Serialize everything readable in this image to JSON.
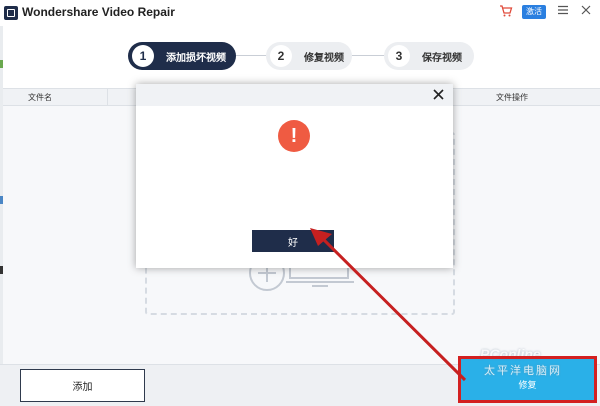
{
  "titlebar": {
    "title": "Wondershare Video Repair",
    "register_label": "激活",
    "icons": [
      "cart-icon",
      "menu-icon",
      "close-icon"
    ]
  },
  "steps": [
    {
      "number": "1",
      "label": "添加损坏视频",
      "state": "active"
    },
    {
      "number": "2",
      "label": "修复视频",
      "state": "inactive"
    },
    {
      "number": "3",
      "label": "保存视频",
      "state": "inactive"
    }
  ],
  "table": {
    "columns": [
      "文件名",
      "文件操作"
    ]
  },
  "dialog": {
    "alert_icon": "!",
    "ok_label": "好"
  },
  "bottom": {
    "add_label": "添加",
    "repair_label": "修复"
  },
  "watermark": {
    "logo": "PConline",
    "sub": "太平洋电脑网"
  },
  "colors": {
    "navy": "#1f2d4a",
    "accent_blue": "#2ab0e8",
    "alert_red": "#ef5b42",
    "annotation_red": "#d32020"
  }
}
